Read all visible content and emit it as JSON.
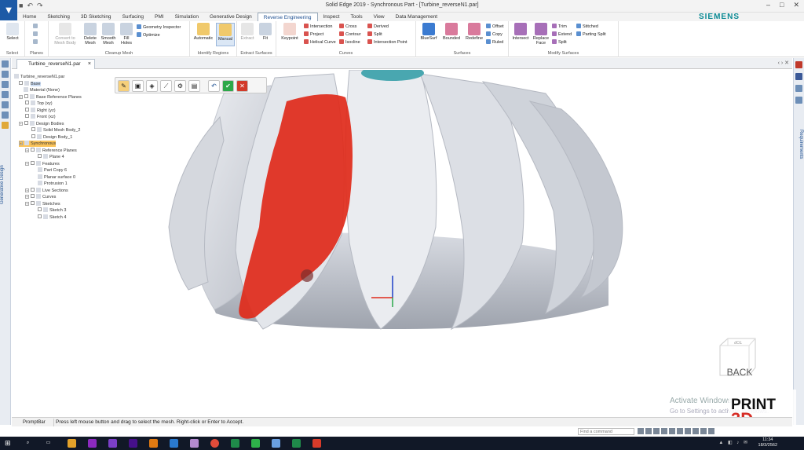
{
  "window": {
    "title": "Solid Edge 2019 - Synchronous Part - [Turbine_reverseN1.par]",
    "controls": [
      "–",
      "□",
      "✕"
    ]
  },
  "ribbon_tabs": [
    "Home",
    "Sketching",
    "3D Sketching",
    "Surfacing",
    "PMI",
    "Simulation",
    "Generative Design",
    "Reverse Engineering",
    "Inspect",
    "Tools",
    "View",
    "Data Management"
  ],
  "active_tab": "Reverse Engineering",
  "brand": "SIEMENS",
  "ribbon": {
    "select": {
      "btn": "Select",
      "group": "Select"
    },
    "planes": {
      "group": "Planes"
    },
    "cleanup": {
      "convert": "Convert to Mesh Body",
      "delete": "Delete Mesh",
      "smooth": "Smooth Mesh",
      "fill": "Fill Holes",
      "inspector": "Geometry Inspector",
      "optimize": "Optimize",
      "group": "Cleanup Mesh"
    },
    "identify": {
      "automatic": "Automatic",
      "manual": "Manual",
      "group": "Identify Regions"
    },
    "extract": {
      "extract": "Extract",
      "fit": "Fit",
      "group": "Extract Surfaces"
    },
    "curves": {
      "keypoint": "Keypoint",
      "intersection": "Intersection",
      "project": "Project",
      "helical": "Helical Curve",
      "cross": "Cross",
      "contour": "Contour",
      "isocline": "Isocline",
      "derived": "Derived",
      "split": "Split",
      "ipoint": "Intersection Point",
      "group": "Curves"
    },
    "surfaces": {
      "bluesurf": "BlueSurf",
      "bounded": "Bounded",
      "redefine": "Redefine",
      "offset": "Offset",
      "copy": "Copy",
      "ruled": "Ruled",
      "group": "Surfaces"
    },
    "modify": {
      "intersect": "Intersect",
      "replace": "Replace Face",
      "trim": "Trim",
      "extend": "Extend",
      "split": "Split",
      "stitched": "Stitched",
      "parting": "Parting Split",
      "group": "Modify Surfaces"
    }
  },
  "doc_tab": "Turbine_reverseN1.par",
  "left_panel_label": "Generative Design",
  "right_panel_label": "Requirements",
  "tree": [
    {
      "label": "Turbine_reverseN1.par"
    },
    {
      "label": "Base"
    },
    {
      "label": "Material (None)"
    },
    {
      "label": "Base Reference Planes"
    },
    {
      "label": "Top (xy)"
    },
    {
      "label": "Right (yz)"
    },
    {
      "label": "Front (xz)"
    },
    {
      "label": "Design Bodies"
    },
    {
      "label": "Solid Mesh Body_2"
    },
    {
      "label": "Design Body_1"
    },
    {
      "label": "Synchronous"
    },
    {
      "label": "Reference Planes"
    },
    {
      "label": "Plane 4"
    },
    {
      "label": "Features"
    },
    {
      "label": "Part Copy 6"
    },
    {
      "label": "Planar surface 0"
    },
    {
      "label": "Protrusion 1"
    },
    {
      "label": "Live Sections"
    },
    {
      "label": "Curves"
    },
    {
      "label": "Sketches"
    },
    {
      "label": "Sketch 3"
    },
    {
      "label": "Sketch 4"
    }
  ],
  "viewport": {
    "back_label": "BACK",
    "cube_top": "TOP",
    "watermark_line1": "Activate Windows",
    "watermark_line2": "Go to Settings to activate Windows.",
    "logo_line1": "PRINT",
    "logo_line2": "3D"
  },
  "status": {
    "tab": "PromptBar",
    "prompt": "Press left mouse button and drag to select the mesh. Right-click or Enter to Accept.",
    "find_placeholder": "Find a command"
  },
  "taskbar": {
    "time": "11:34",
    "date": "18/3/2562"
  },
  "colors": {
    "accent": "#1d4f91",
    "selection_red": "#e02a1a",
    "brand": "#0b8a94",
    "tree_highlight": "#fbc45b"
  }
}
